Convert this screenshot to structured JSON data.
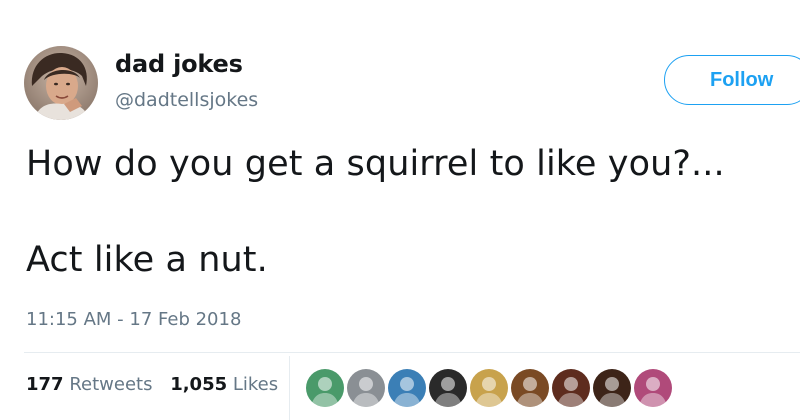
{
  "author": {
    "display_name": "dad jokes",
    "handle": "@dadtellsjokes",
    "avatar_icon": "profile-photo"
  },
  "follow_button": {
    "label": "Follow",
    "color": "#1da1f2"
  },
  "tweet": {
    "line1": "How do you get a squirrel to like you?...",
    "line2": "Act like a nut.",
    "timestamp": "11:15 AM - 17 Feb 2018"
  },
  "stats": {
    "retweets_count": "177",
    "retweets_label": "Retweets",
    "likes_count": "1,055",
    "likes_label": "Likes"
  },
  "likers": [
    {
      "icon": "liker-avatar",
      "color": "#4a9a6a"
    },
    {
      "icon": "liker-avatar",
      "color": "#8a8f94"
    },
    {
      "icon": "liker-avatar",
      "color": "#3b7fb6"
    },
    {
      "icon": "liker-avatar",
      "color": "#2a2a2a"
    },
    {
      "icon": "liker-avatar",
      "color": "#c8a24c"
    },
    {
      "icon": "liker-avatar",
      "color": "#7a4a24"
    },
    {
      "icon": "liker-avatar",
      "color": "#5e2c1e"
    },
    {
      "icon": "liker-avatar",
      "color": "#3d2418"
    },
    {
      "icon": "liker-avatar",
      "color": "#b04a7a"
    }
  ],
  "colors": {
    "text_primary": "#14171a",
    "text_secondary": "#657786",
    "accent": "#1da1f2",
    "divider": "#e6ecf0"
  }
}
